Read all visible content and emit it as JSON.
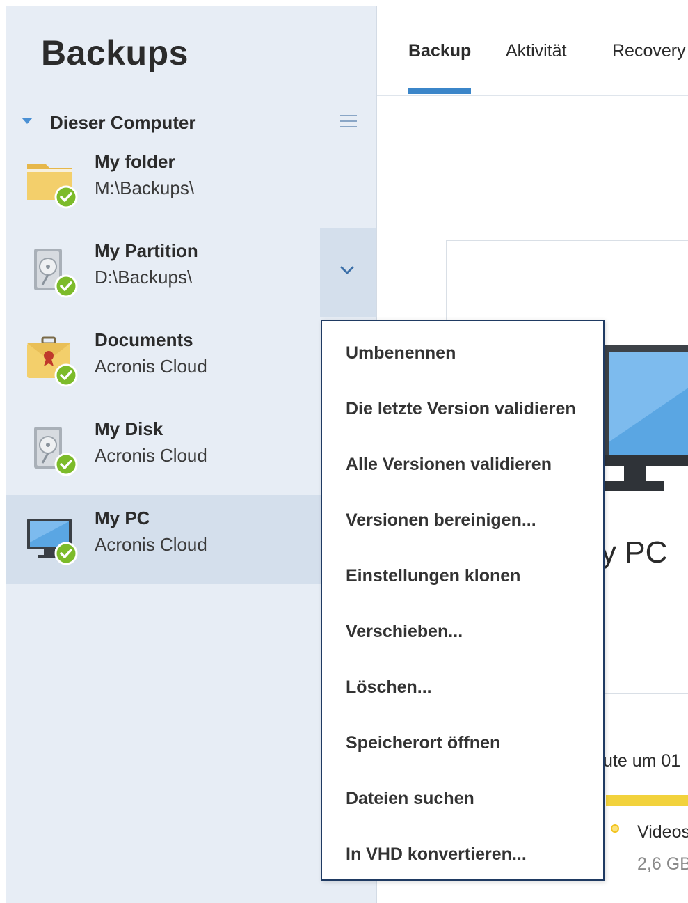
{
  "sidebar": {
    "title": "Backups",
    "group": {
      "label": "Dieser Computer"
    },
    "items": [
      {
        "name": "My folder",
        "subtitle": "M:\\Backups\\",
        "icon": "folder-icon",
        "status": "ok"
      },
      {
        "name": "My Partition",
        "subtitle": "D:\\Backups\\",
        "icon": "hard-drive-icon",
        "status": "ok"
      },
      {
        "name": "Documents",
        "subtitle": "Acronis Cloud",
        "icon": "briefcase-icon",
        "status": "ok"
      },
      {
        "name": "My Disk",
        "subtitle": "Acronis Cloud",
        "icon": "hard-drive-icon",
        "status": "ok"
      },
      {
        "name": "My PC",
        "subtitle": "Acronis Cloud",
        "icon": "monitor-icon",
        "status": "ok",
        "selected": true
      }
    ]
  },
  "tabs": [
    {
      "label": "Backup",
      "active": true
    },
    {
      "label": "Aktivität"
    },
    {
      "label": "Recovery"
    }
  ],
  "main": {
    "title": "y PC",
    "schedule_text": "ute um 01",
    "legend": {
      "label": "Videos",
      "value": "2,6 GB"
    }
  },
  "context_menu": {
    "items": [
      "Umbenennen",
      "Die letzte Version validieren",
      "Alle Versionen validieren",
      "Versionen bereinigen...",
      "Einstellungen klonen",
      "Verschieben...",
      "Löschen...",
      "Speicherort öffnen",
      "Dateien suchen",
      "In VHD konvertieren..."
    ]
  },
  "colors": {
    "accent": "#3b86c9",
    "sidebar_bg": "#e7edf5",
    "selected_bg": "#d4dfec",
    "status_ok": "#7cbb2a",
    "storage_bar": "#f2d23c"
  }
}
